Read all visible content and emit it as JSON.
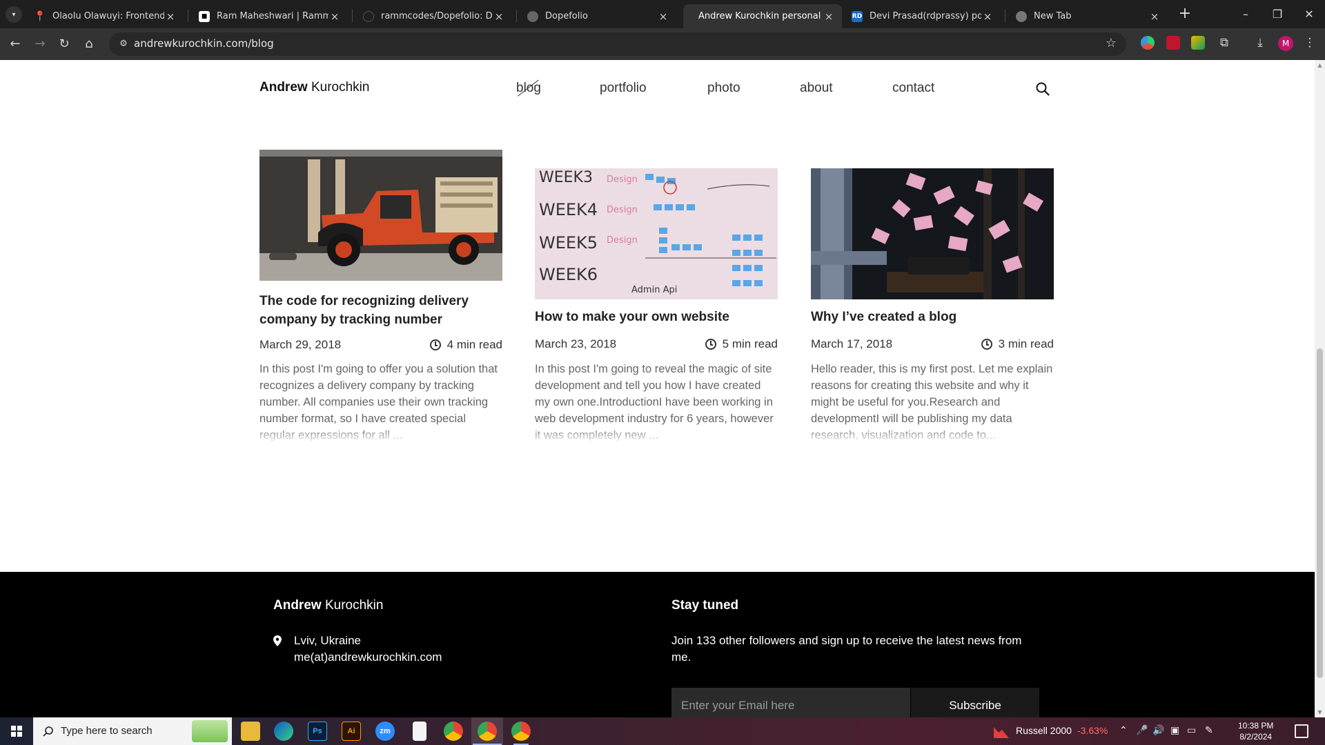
{
  "browser": {
    "tabs": [
      {
        "title": "Olaolu Olawuyi: Frontend developer",
        "favicon_color": "#7b3fe4",
        "favicon_glyph": "pin-icon"
      },
      {
        "title": "Ram Maheshwari | RammCodes",
        "favicon_color": "#ffffff",
        "favicon_glyph": "person-icon"
      },
      {
        "title": "rammcodes/Dopefolio: Dopefolio",
        "favicon_color": "#1f1f1f",
        "favicon_glyph": "github-icon"
      },
      {
        "title": "Dopefolio",
        "favicon_color": "#555555",
        "favicon_glyph": "globe-icon"
      },
      {
        "title": "Andrew Kurochkin personal blog",
        "favicon_color": "#333333",
        "favicon_glyph": "none"
      },
      {
        "title": "Devi Prasad(rdprassy) portfolio",
        "favicon_color": "#1b6ec2",
        "favicon_glyph": "RD"
      },
      {
        "title": "New Tab",
        "favicon_color": "#555555",
        "favicon_glyph": "chrome-icon"
      }
    ],
    "active_tab": 4,
    "url": "andrewkurochkin.com/blog",
    "profile_initial": "M"
  },
  "site": {
    "brand_first": "Andrew",
    "brand_last": "Kurochkin",
    "nav": [
      {
        "label": "blog",
        "active": true
      },
      {
        "label": "portfolio",
        "active": false
      },
      {
        "label": "photo",
        "active": false
      },
      {
        "label": "about",
        "active": false
      },
      {
        "label": "contact",
        "active": false
      }
    ]
  },
  "posts": [
    {
      "title": "The code for recognizing delivery company by tracking number",
      "date": "March 29, 2018",
      "read": "4 min read",
      "excerpt": "In this post I'm going to offer you a solution that recognizes a delivery company by tracking number. All companies use their own tracking number format, so I have created special regular expressions for all ...",
      "image": "red-truck-photo"
    },
    {
      "title": "How to make your own website",
      "date": "March 23, 2018",
      "read": "5 min read",
      "excerpt": "In this post I'm going to reveal the magic of site development and tell you how I have created my own one.IntroductionI have been working in web development industry for 6 years, however it was completely new ...",
      "image": "whiteboard-weeks-photo"
    },
    {
      "title": "Why I’ve created a blog",
      "date": "March 17, 2018",
      "read": "3 min read",
      "excerpt": "Hello reader, this is my first post. Let me explain reasons for creating this website and why it might be useful for you.Research and developmentI will be publishing my data research, visualization and code to...",
      "image": "typewriter-flying-papers-photo"
    }
  ],
  "footer": {
    "brand_first": "Andrew",
    "brand_last": "Kurochkin",
    "location": "Lviv, Ukraine",
    "email": "me(at)andrewkurochkin.com",
    "stay_title": "Stay tuned",
    "join_text": "Join 133 other followers and sign up to receive the latest news from me.",
    "email_placeholder": "Enter your Email here",
    "subscribe_label": "Subscribe"
  },
  "taskbar": {
    "search_placeholder": "Type here to search",
    "stock_name": "Russell 2000",
    "stock_change": "-3.63%",
    "time": "10:38 PM",
    "date": "8/2/2024"
  },
  "colors": {
    "page_bg": "#ffffff",
    "footer_bg": "#000000",
    "chrome_bg": "#1f1f1f",
    "toolbar_bg": "#333333",
    "stock_negative": "#ff6b6b"
  }
}
